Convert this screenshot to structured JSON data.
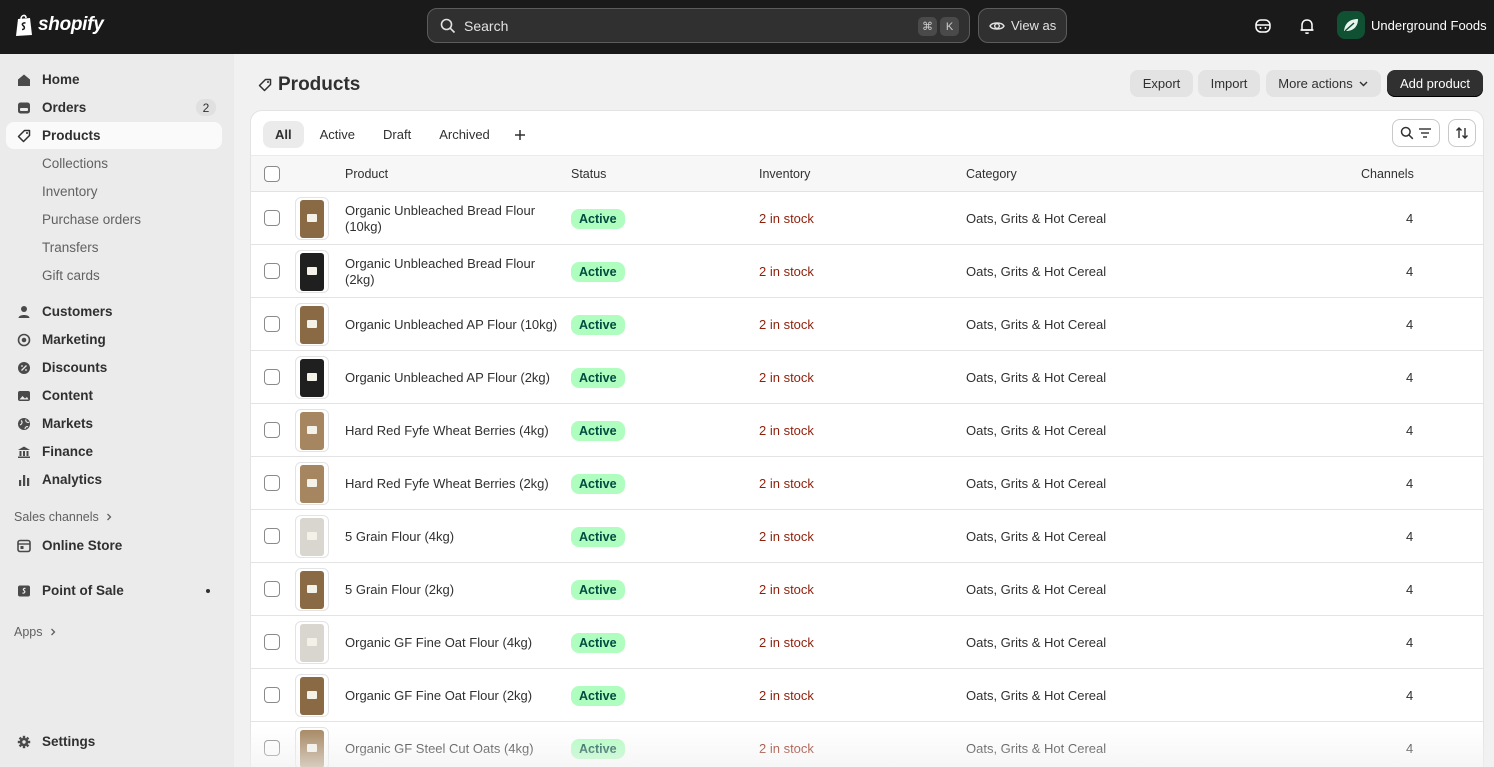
{
  "topbar": {
    "brand": "shopify",
    "search_placeholder": "Search",
    "shortcut_keys": [
      "⌘",
      "K"
    ],
    "view_as_label": "View as",
    "store_name": "Underground Foods"
  },
  "sidebar": {
    "items": [
      {
        "label": "Home",
        "icon": "home-icon"
      },
      {
        "label": "Orders",
        "icon": "orders-icon",
        "badge": "2"
      },
      {
        "label": "Products",
        "icon": "tag-icon",
        "active": true
      }
    ],
    "product_subitems": [
      "Collections",
      "Inventory",
      "Purchase orders",
      "Transfers",
      "Gift cards"
    ],
    "items2": [
      {
        "label": "Customers",
        "icon": "person-icon"
      },
      {
        "label": "Marketing",
        "icon": "target-icon"
      },
      {
        "label": "Discounts",
        "icon": "discount-icon"
      },
      {
        "label": "Content",
        "icon": "image-icon"
      },
      {
        "label": "Markets",
        "icon": "globe-icon"
      },
      {
        "label": "Finance",
        "icon": "bank-icon"
      },
      {
        "label": "Analytics",
        "icon": "chart-icon"
      }
    ],
    "sales_channels_label": "Sales channels",
    "online_store_label": "Online Store",
    "point_of_sale_label": "Point of Sale",
    "apps_label": "Apps",
    "settings_label": "Settings"
  },
  "page": {
    "title": "Products",
    "export_label": "Export",
    "import_label": "Import",
    "more_actions_label": "More actions",
    "add_product_label": "Add product"
  },
  "tabs": [
    "All",
    "Active",
    "Draft",
    "Archived"
  ],
  "table": {
    "headers": {
      "product": "Product",
      "status": "Status",
      "inventory": "Inventory",
      "category": "Category",
      "channels": "Channels"
    },
    "rows": [
      {
        "name": "Organic Unbleached Bread Flour (10kg)",
        "status": "Active",
        "inventory": "2 in stock",
        "category": "Oats, Grits & Hot Cereal",
        "channels": "4",
        "thumb": "kraft"
      },
      {
        "name": "Organic Unbleached Bread Flour (2kg)",
        "status": "Active",
        "inventory": "2 in stock",
        "category": "Oats, Grits & Hot Cereal",
        "channels": "4",
        "thumb": "dark"
      },
      {
        "name": "Organic Unbleached AP Flour (10kg)",
        "status": "Active",
        "inventory": "2 in stock",
        "category": "Oats, Grits & Hot Cereal",
        "channels": "4",
        "thumb": "kraft"
      },
      {
        "name": "Organic Unbleached AP Flour (2kg)",
        "status": "Active",
        "inventory": "2 in stock",
        "category": "Oats, Grits & Hot Cereal",
        "channels": "4",
        "thumb": "dark"
      },
      {
        "name": "Hard Red Fyfe Wheat Berries (4kg)",
        "status": "Active",
        "inventory": "2 in stock",
        "category": "Oats, Grits & Hot Cereal",
        "channels": "4",
        "thumb": "grain"
      },
      {
        "name": "Hard Red Fyfe Wheat Berries (2kg)",
        "status": "Active",
        "inventory": "2 in stock",
        "category": "Oats, Grits & Hot Cereal",
        "channels": "4",
        "thumb": "grain"
      },
      {
        "name": "5 Grain Flour (4kg)",
        "status": "Active",
        "inventory": "2 in stock",
        "category": "Oats, Grits & Hot Cereal",
        "channels": "4",
        "thumb": "clear"
      },
      {
        "name": "5 Grain Flour (2kg)",
        "status": "Active",
        "inventory": "2 in stock",
        "category": "Oats, Grits & Hot Cereal",
        "channels": "4",
        "thumb": "kraft"
      },
      {
        "name": "Organic GF Fine Oat Flour (4kg)",
        "status": "Active",
        "inventory": "2 in stock",
        "category": "Oats, Grits & Hot Cereal",
        "channels": "4",
        "thumb": "clear"
      },
      {
        "name": "Organic GF Fine Oat Flour (2kg)",
        "status": "Active",
        "inventory": "2 in stock",
        "category": "Oats, Grits & Hot Cereal",
        "channels": "4",
        "thumb": "kraft"
      },
      {
        "name": "Organic GF Steel Cut Oats (4kg)",
        "status": "Active",
        "inventory": "2 in stock",
        "category": "Oats, Grits & Hot Cereal",
        "channels": "4",
        "thumb": "grain"
      }
    ]
  },
  "colors": {
    "topbar": "#1a1a1a",
    "status_active_bg": "#affebf",
    "status_active_text": "#014b40",
    "inventory_low": "#8e1f0b",
    "primary_button": "#303030"
  }
}
